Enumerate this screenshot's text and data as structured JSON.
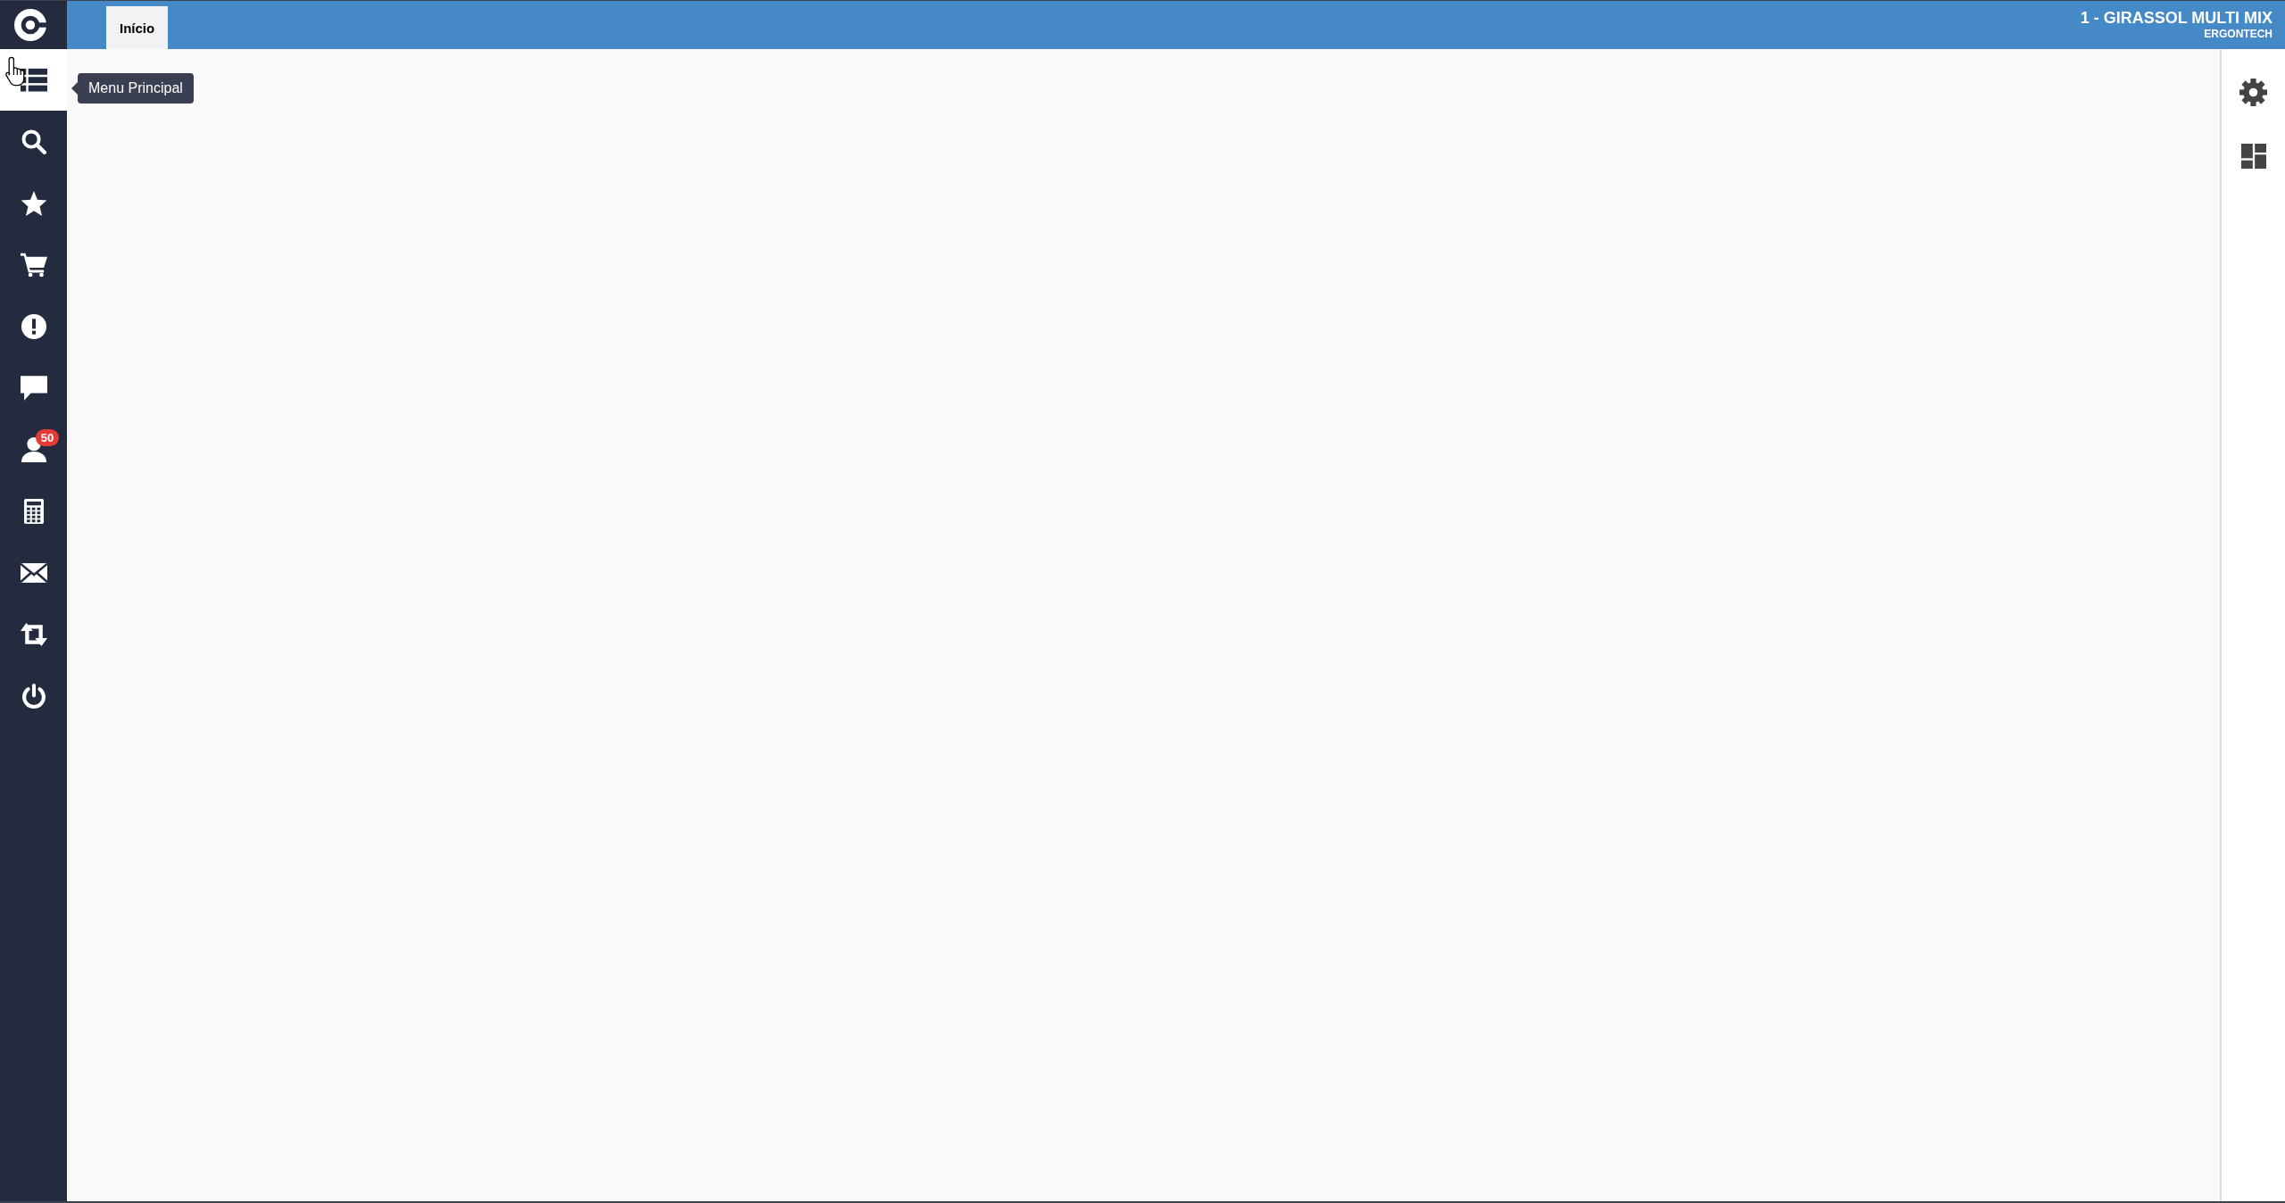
{
  "sidebar": {
    "items": [
      {
        "kind": "menu",
        "selected": true,
        "tooltip": "Menu Principal"
      },
      {
        "kind": "search",
        "selected": false
      },
      {
        "kind": "favorites",
        "selected": false
      },
      {
        "kind": "cart",
        "selected": false
      },
      {
        "kind": "alerts",
        "selected": false
      },
      {
        "kind": "messages",
        "selected": false
      },
      {
        "kind": "users",
        "selected": false,
        "badge": "50"
      },
      {
        "kind": "calculator",
        "selected": false
      },
      {
        "kind": "mail",
        "selected": false
      },
      {
        "kind": "switch",
        "selected": false
      },
      {
        "kind": "power",
        "selected": false
      }
    ]
  },
  "header": {
    "tabs": [
      {
        "label": "Início",
        "selected": true
      }
    ],
    "company": "1 - GIRASSOL MULTI MIX",
    "company_subtitle": "ERGONTECH"
  },
  "right_panel": {
    "tools": [
      {
        "kind": "settings"
      },
      {
        "kind": "layout"
      }
    ]
  }
}
